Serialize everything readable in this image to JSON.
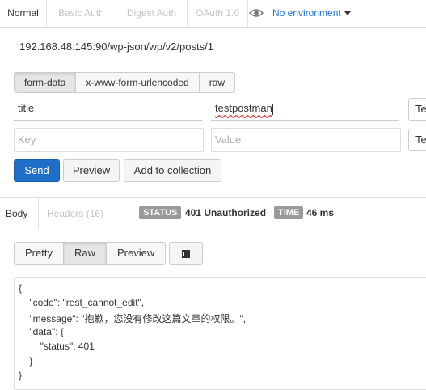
{
  "auth_tabs": [
    "Normal",
    "Basic Auth",
    "Digest Auth",
    "OAuth 1.0"
  ],
  "environment": {
    "label": "No environment"
  },
  "request": {
    "url": "192.168.48.145:90/wp-json/wp/v2/posts/1"
  },
  "body_types": [
    "form-data",
    "x-www-form-urlencoded",
    "raw"
  ],
  "params": [
    {
      "key": "title",
      "value": "testpostman",
      "type": "Te"
    }
  ],
  "param_placeholder": {
    "key": "Key",
    "value": "Value",
    "type": "Te"
  },
  "actions": {
    "send": "Send",
    "preview": "Preview",
    "add": "Add to collection"
  },
  "response": {
    "tabs": [
      "Body",
      "Headers (16)"
    ],
    "status_label": "STATUS",
    "status_value": "401 Unauthorized",
    "time_label": "TIME",
    "time_value": "46 ms",
    "view_modes": [
      "Pretty",
      "Raw",
      "Preview"
    ],
    "body_lines": [
      "{",
      "    \"code\": \"rest_cannot_edit\",",
      "    \"message\": \"抱歉，您没有修改这篇文章的权限。\",",
      "    \"data\": {",
      "        \"status\": 401",
      "    }",
      "}"
    ]
  },
  "colors": {
    "primary": "#1f6fc9",
    "link": "#1a73d9",
    "badge": "#9a9a9a"
  }
}
